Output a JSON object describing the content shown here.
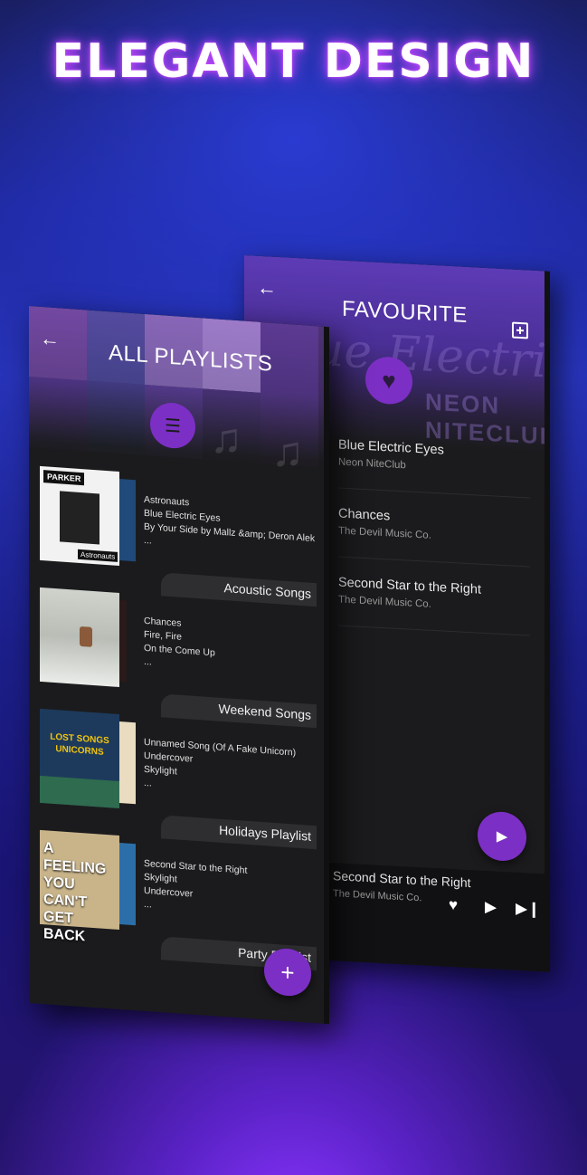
{
  "headline": "ELEGANT DESIGN",
  "favourite": {
    "title": "FAVOURITE",
    "header_art_script": "Blue Electric Eyes",
    "header_art_band": "NEON NITECLUB",
    "songs": [
      {
        "title": "Blue Electric Eyes",
        "artist": "Neon NiteClub"
      },
      {
        "title": "Chances",
        "artist": "The Devil Music Co."
      },
      {
        "title": "Second Star to the Right",
        "artist": "The Devil Music Co."
      }
    ],
    "now_playing": {
      "title": "Second Star to the Right",
      "artist": "The Devil Music Co."
    }
  },
  "all_playlists": {
    "title": "ALL PLAYLISTS",
    "playlists": [
      {
        "name": "Acoustic Songs",
        "songs": [
          "Astronauts",
          "Blue Electric Eyes",
          "By Your Side by Mallz &amp; Deron Alek",
          "..."
        ],
        "cover_text": "PARKER",
        "cover_sub": "Astronauts"
      },
      {
        "name": "Weekend Songs",
        "songs": [
          "Chances",
          "Fire, Fire",
          "On the Come Up",
          "..."
        ]
      },
      {
        "name": "Holidays Playlist",
        "songs": [
          "Unnamed Song (Of A Fake Unicorn)",
          "Undercover",
          "Skylight",
          "..."
        ],
        "cover_text": "LOST SONGS UNICORNS"
      },
      {
        "name": "Party Playlist",
        "songs": [
          "Second Star to the Right",
          "Skylight",
          "Undercover",
          "..."
        ],
        "cover_text": "A FEELING YOU CAN'T GET BACK"
      }
    ]
  },
  "colors": {
    "accent": "#7c2fc4",
    "panel": "#1b1b1d",
    "tab": "#2e2e31"
  }
}
